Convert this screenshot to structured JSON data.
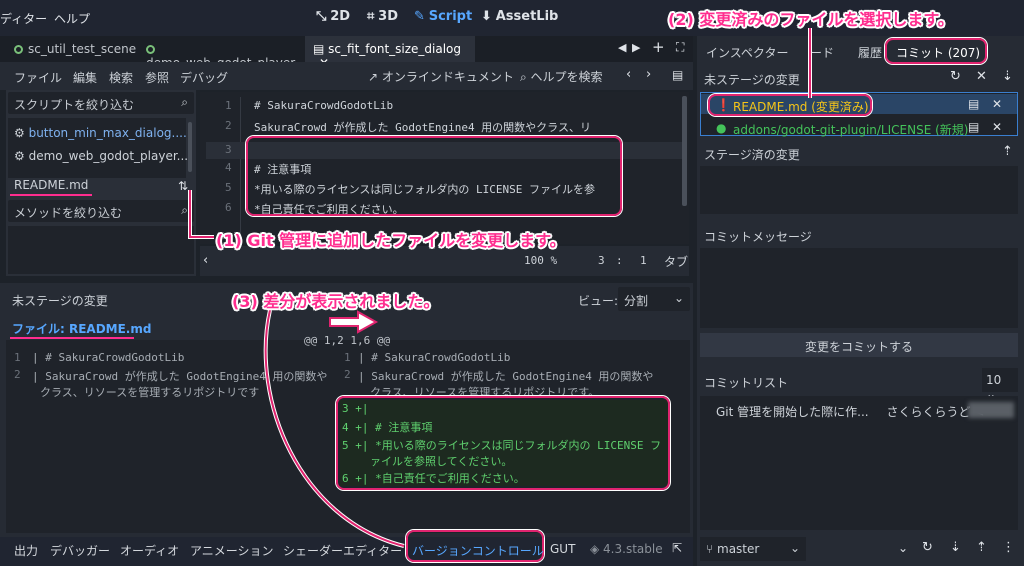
{
  "menubar": {
    "items": [
      "ディター",
      "ヘルプ"
    ],
    "workspaces": [
      "2D",
      "3D",
      "Script",
      "AssetLib"
    ],
    "active_workspace": "Script"
  },
  "script_tabs": [
    {
      "label": "sc_util_test_scene",
      "active": false
    },
    {
      "label": "demo_web_godot_player",
      "active": false
    },
    {
      "label": "sc_fit_font_size_dialog",
      "active": true
    }
  ],
  "script_toolbar": {
    "menus": [
      "ファイル",
      "編集",
      "検索",
      "参照",
      "デバッグ"
    ],
    "online_docs": "オンラインドキュメント",
    "search_help": "ヘルプを検索"
  },
  "left_panel": {
    "script_filter_placeholder": "スクリプトを絞り込む",
    "scripts": [
      "button_min_max_dialog....",
      "demo_web_godot_player..."
    ],
    "current_file": "README.md",
    "method_filter_placeholder": "メソッドを絞り込む"
  },
  "code_editor": {
    "lines": [
      {
        "n": "1",
        "text": "# SakuraCrowdGodotLib"
      },
      {
        "n": "2",
        "text": " SakuraCrowd が作成した GodotEngine4 用の関数やクラス、リ"
      },
      {
        "n": "3",
        "text": ""
      },
      {
        "n": "4",
        "text": "# 注意事項"
      },
      {
        "n": "5",
        "text": "*用いる際のライセンスは同じフォルダ内の LICENSE ファイルを参"
      },
      {
        "n": "6",
        "text": "*自己責任でご利用ください。"
      }
    ],
    "status": {
      "zoom": "100 %",
      "line": "3",
      "col": "1",
      "indent": "タブ"
    }
  },
  "diff_panel": {
    "title": "未ステージの変更",
    "view_label": "ビュー:",
    "view_value": "分割",
    "file_label": "ファイル: README.md",
    "hunk": "@@ 1,2 1,6 @@",
    "left_lines": [
      {
        "n": "1",
        "text": "# SakuraCrowdGodotLib"
      },
      {
        "n": "2",
        "text": " SakuraCrowd が作成した GodotEngine4 用の関数や"
      },
      {
        "n": "",
        "text": "クラス、リソースを管理するリポジトリです"
      }
    ],
    "right_lines": [
      {
        "n": "1",
        "text": "# SakuraCrowdGodotLib"
      },
      {
        "n": "2",
        "text": " SakuraCrowd が作成した GodotEngine4 用の関数や"
      },
      {
        "n": "",
        "text": "クラス、リソースを管理するリポジトリです。"
      }
    ],
    "added_lines": [
      {
        "n": "3",
        "text": ""
      },
      {
        "n": "4",
        "text": "# 注意事項"
      },
      {
        "n": "5",
        "text": "*用いる際のライセンスは同じフォルダ内の LICENSE フ"
      },
      {
        "n": "",
        "text": "ァイルを参照してください。"
      },
      {
        "n": "6",
        "text": "*自己責任でご利用ください。"
      }
    ]
  },
  "bottom_tabs": [
    "出力",
    "デバッガー",
    "オーディオ",
    "アニメーション",
    "シェーダーエディター",
    "バージョンコントロール",
    "GUT"
  ],
  "version": "4.3.stable",
  "right_dock": {
    "tabs": [
      "インスペクター",
      "ード",
      "履歴",
      "コミット (207)"
    ],
    "unstaged_title": "未ステージの変更",
    "unstaged_files": [
      {
        "name": "README.md (変更済み)",
        "status": "modified"
      },
      {
        "name": "addons/godot-git-plugin/LICENSE (新規)",
        "status": "new"
      }
    ],
    "staged_title": "ステージ済の変更",
    "commit_message_title": "コミットメッセージ",
    "commit_button": "変更をコミットする",
    "commit_list_title": "コミットリスト",
    "commit_list_count": "10",
    "commits": [
      {
        "message": "Git 管理を開始した際に作...",
        "author": "さくらくらうど <"
      }
    ],
    "branch": "master"
  },
  "annotations": {
    "step1": "(1) Git 管理に追加したファイルを変更します。",
    "step2": "(2) 変更済みのファイルを選択します。",
    "step3": "(3) 差分が表示されました。"
  },
  "colors": {
    "accent": "#57a7ff",
    "annotation": "#ff2d8f",
    "added": "#44c35a",
    "modified": "#f5c518"
  }
}
